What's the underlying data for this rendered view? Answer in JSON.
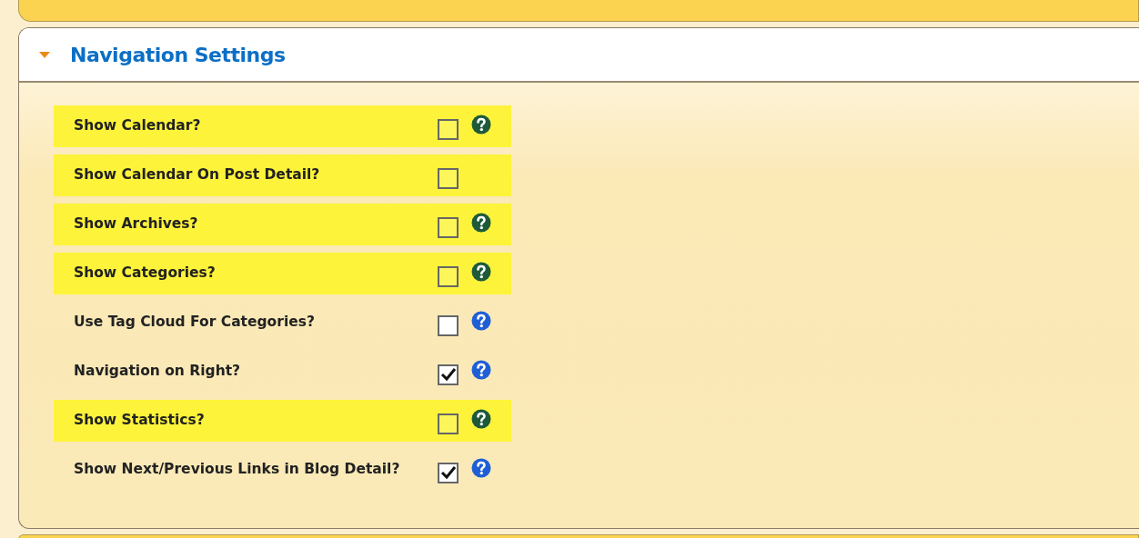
{
  "panel": {
    "title": "Navigation Settings",
    "expanded": true
  },
  "settings": [
    {
      "label": "Show Calendar?",
      "checked": false,
      "highlighted": true,
      "help": true
    },
    {
      "label": "Show Calendar On Post Detail?",
      "checked": false,
      "highlighted": true,
      "help": false
    },
    {
      "label": "Show Archives?",
      "checked": false,
      "highlighted": true,
      "help": true
    },
    {
      "label": "Show Categories?",
      "checked": false,
      "highlighted": true,
      "help": true
    },
    {
      "label": "Use Tag Cloud For Categories?",
      "checked": false,
      "highlighted": false,
      "help": true
    },
    {
      "label": "Navigation on Right?",
      "checked": true,
      "highlighted": false,
      "help": true
    },
    {
      "label": "Show Statistics?",
      "checked": false,
      "highlighted": true,
      "help": true
    },
    {
      "label": "Show Next/Previous Links in Blog Detail?",
      "checked": true,
      "highlighted": false,
      "help": true
    }
  ]
}
